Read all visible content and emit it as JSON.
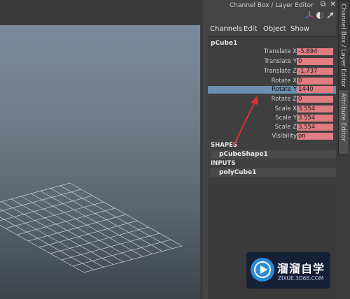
{
  "window": {
    "title": "Channel Box / Layer Editor"
  },
  "window_controls": [
    "⧉",
    "✕"
  ],
  "toolbar_icons": [
    "axes-icon",
    "half-circle-icon",
    "arrow-icon"
  ],
  "menu": [
    "Channels",
    "Edit",
    "Object",
    "Show"
  ],
  "object": {
    "name": "pCube1",
    "channels": [
      {
        "label": "Translate X",
        "value": "-5.894"
      },
      {
        "label": "Translate Y",
        "value": "0"
      },
      {
        "label": "Translate Z",
        "value": "-1.737"
      },
      {
        "label": "Rotate X",
        "value": "0"
      },
      {
        "label": "Rotate Y",
        "value": "1440"
      },
      {
        "label": "Rotate Z",
        "value": "0"
      },
      {
        "label": "Scale X",
        "value": "3.554"
      },
      {
        "label": "Scale Y",
        "value": "3.554"
      },
      {
        "label": "Scale Z",
        "value": "3.554"
      },
      {
        "label": "Visibility",
        "value": "on"
      }
    ],
    "selected_channel": "Rotate Y"
  },
  "shapes": {
    "header": "SHAPES",
    "node": "pCubeShape1"
  },
  "inputs": {
    "header": "INPUTS",
    "node": "polyCube1"
  },
  "side_tabs": [
    "Channel Box / Layer Editor",
    "Attribute Editor"
  ],
  "watermark": {
    "name": "溜溜自学",
    "url": "ZIXUE.3D66.COM"
  },
  "colors": {
    "value_field": "#e07c82",
    "selection": "#6a8fb0",
    "annotation_arrow": "#e03030"
  }
}
